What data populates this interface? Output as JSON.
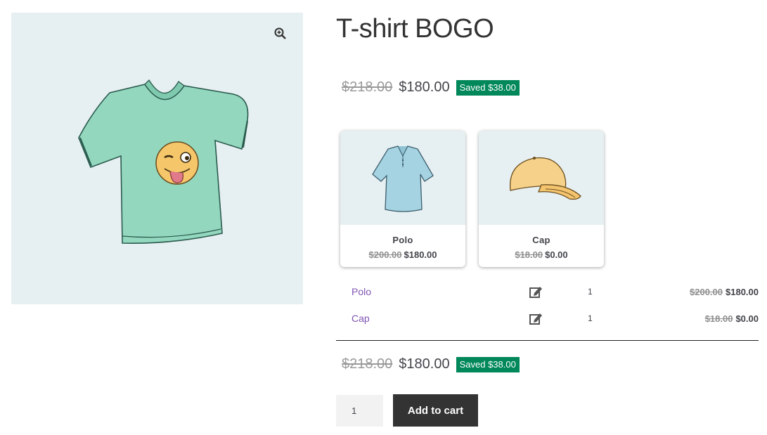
{
  "product": {
    "title": "T-shirt BOGO",
    "image": "tshirt-image",
    "zoom_icon": "zoom-in-icon"
  },
  "price_summary": {
    "regular": "$218.00",
    "sale": "$180.00",
    "saved": "Saved $38.00"
  },
  "bundle_cards": [
    {
      "name": "Polo",
      "regular": "$200.00",
      "sale": "$180.00",
      "image": "polo-image"
    },
    {
      "name": "Cap",
      "regular": "$18.00",
      "sale": "$0.00",
      "image": "cap-image"
    }
  ],
  "bundle_items": [
    {
      "name": "Polo",
      "edit_icon": "edit-icon",
      "qty": "1",
      "regular": "$200.00",
      "sale": "$180.00"
    },
    {
      "name": "Cap",
      "edit_icon": "edit-icon",
      "qty": "1",
      "regular": "$18.00",
      "sale": "$0.00"
    }
  ],
  "cart": {
    "qty_value": "1",
    "add_label": "Add to cart"
  },
  "colors": {
    "saved_badge": "#00875a",
    "link": "#7f54b3",
    "button": "#333333",
    "image_bg": "#e6eff1"
  }
}
